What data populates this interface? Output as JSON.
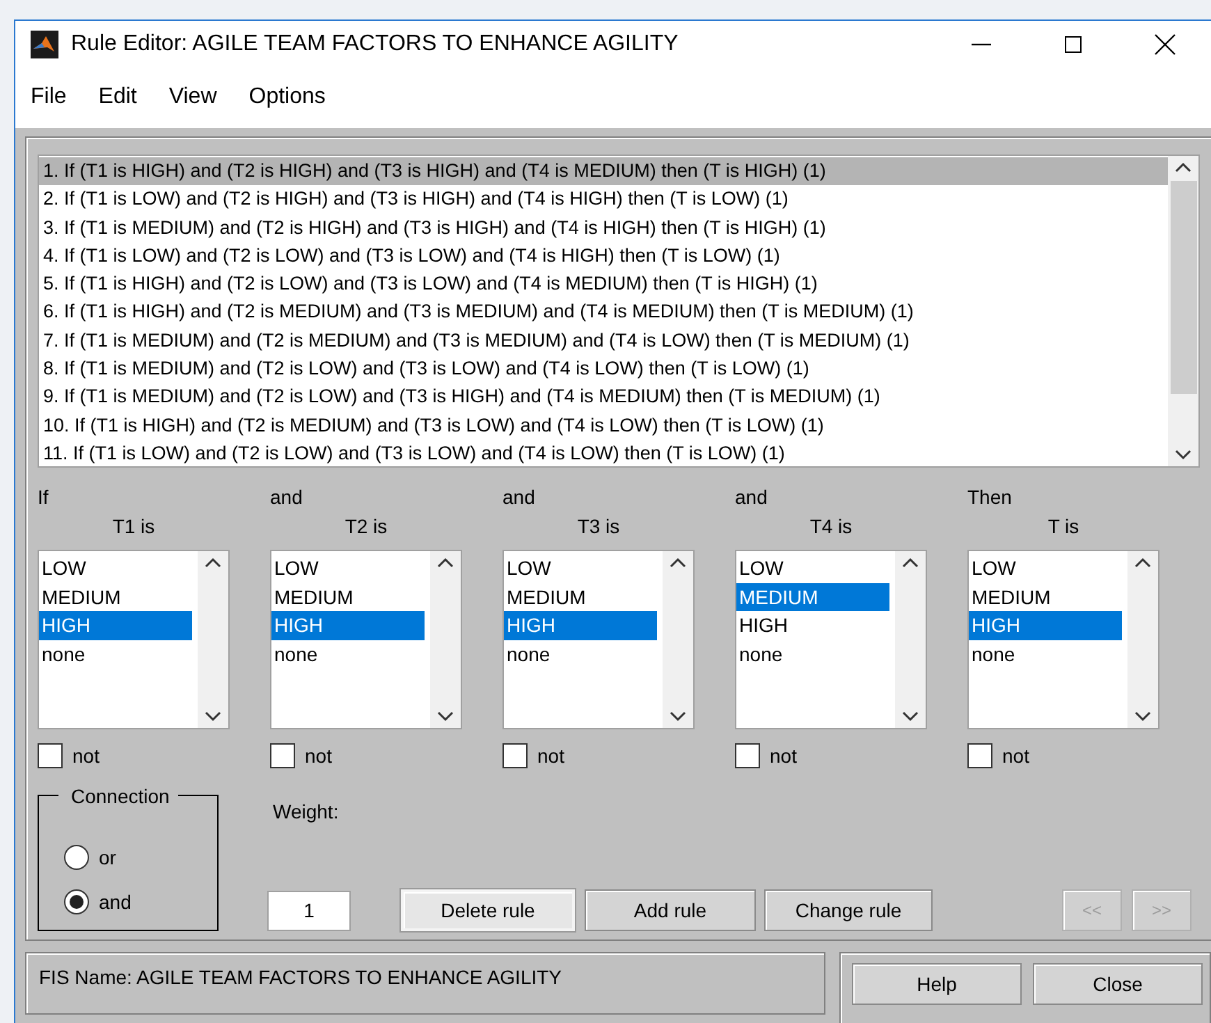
{
  "window": {
    "title": "Rule Editor: AGILE TEAM FACTORS TO ENHANCE AGILITY"
  },
  "menu": [
    "File",
    "Edit",
    "View",
    "Options"
  ],
  "rules": [
    {
      "text": "1. If (T1 is HIGH) and (T2 is HIGH) and (T3 is HIGH) and (T4 is MEDIUM) then (T is HIGH) (1)",
      "selected": true
    },
    {
      "text": "2. If (T1 is LOW) and (T2 is HIGH) and (T3 is HIGH) and (T4 is HIGH) then (T is LOW) (1)",
      "selected": false
    },
    {
      "text": "3. If (T1 is MEDIUM) and (T2 is HIGH) and (T3 is HIGH) and (T4 is HIGH) then (T is HIGH) (1)",
      "selected": false
    },
    {
      "text": "4. If (T1 is LOW) and (T2 is LOW) and (T3 is LOW) and (T4 is HIGH) then (T is LOW) (1)",
      "selected": false
    },
    {
      "text": "5. If (T1 is HIGH) and (T2 is LOW) and (T3 is LOW) and (T4 is MEDIUM) then (T is HIGH) (1)",
      "selected": false
    },
    {
      "text": "6. If (T1 is HIGH) and (T2 is MEDIUM) and (T3 is MEDIUM) and (T4 is MEDIUM) then (T is MEDIUM) (1)",
      "selected": false
    },
    {
      "text": "7. If (T1 is MEDIUM) and (T2 is MEDIUM) and (T3 is MEDIUM) and (T4 is LOW) then (T is MEDIUM) (1)",
      "selected": false
    },
    {
      "text": "8. If (T1 is MEDIUM) and (T2 is LOW) and (T3 is LOW) and (T4 is LOW) then (T is LOW) (1)",
      "selected": false
    },
    {
      "text": "9. If (T1 is MEDIUM) and (T2 is LOW) and (T3 is HIGH) and (T4 is MEDIUM) then (T is MEDIUM) (1)",
      "selected": false
    },
    {
      "text": "10. If (T1 is HIGH) and (T2 is MEDIUM) and (T3 is LOW) and (T4 is LOW) then (T is LOW) (1)",
      "selected": false
    },
    {
      "text": "11. If (T1 is LOW) and (T2 is LOW) and (T3 is LOW) and (T4 is LOW) then (T is LOW) (1)",
      "selected": false
    }
  ],
  "variables": [
    {
      "connector": "If",
      "label": "T1 is",
      "options": [
        {
          "text": "LOW",
          "selected": false
        },
        {
          "text": "MEDIUM",
          "selected": false
        },
        {
          "text": "HIGH",
          "selected": true
        },
        {
          "text": "none",
          "selected": false
        }
      ],
      "not_label": "not",
      "not_checked": false
    },
    {
      "connector": "and",
      "label": "T2 is",
      "options": [
        {
          "text": "LOW",
          "selected": false
        },
        {
          "text": "MEDIUM",
          "selected": false
        },
        {
          "text": "HIGH",
          "selected": true
        },
        {
          "text": "none",
          "selected": false
        }
      ],
      "not_label": "not",
      "not_checked": false
    },
    {
      "connector": "and",
      "label": "T3 is",
      "options": [
        {
          "text": "LOW",
          "selected": false
        },
        {
          "text": "MEDIUM",
          "selected": false
        },
        {
          "text": "HIGH",
          "selected": true
        },
        {
          "text": "none",
          "selected": false
        }
      ],
      "not_label": "not",
      "not_checked": false
    },
    {
      "connector": "and",
      "label": "T4 is",
      "options": [
        {
          "text": "LOW",
          "selected": false
        },
        {
          "text": "MEDIUM",
          "selected": true
        },
        {
          "text": "HIGH",
          "selected": false
        },
        {
          "text": "none",
          "selected": false
        }
      ],
      "not_label": "not",
      "not_checked": false
    },
    {
      "connector": "Then",
      "label": "T is",
      "options": [
        {
          "text": "LOW",
          "selected": false
        },
        {
          "text": "MEDIUM",
          "selected": false
        },
        {
          "text": "HIGH",
          "selected": true
        },
        {
          "text": "none",
          "selected": false
        }
      ],
      "not_label": "not",
      "not_checked": false
    }
  ],
  "connection": {
    "title": "Connection",
    "options": [
      {
        "label": "or",
        "selected": false
      },
      {
        "label": "and",
        "selected": true
      }
    ]
  },
  "weight": {
    "label": "Weight:",
    "value": "1"
  },
  "buttons": [
    {
      "label": "Delete rule",
      "focused": true,
      "disabled": false
    },
    {
      "label": "Add rule",
      "focused": false,
      "disabled": false
    },
    {
      "label": "Change rule",
      "focused": false,
      "disabled": false
    }
  ],
  "nav_buttons": [
    {
      "label": "<<",
      "disabled": true
    },
    {
      "label": ">>",
      "disabled": true
    }
  ],
  "status": "FIS Name: AGILE TEAM FACTORS TO ENHANCE AGILITY",
  "footer_buttons": [
    "Help",
    "Close"
  ]
}
